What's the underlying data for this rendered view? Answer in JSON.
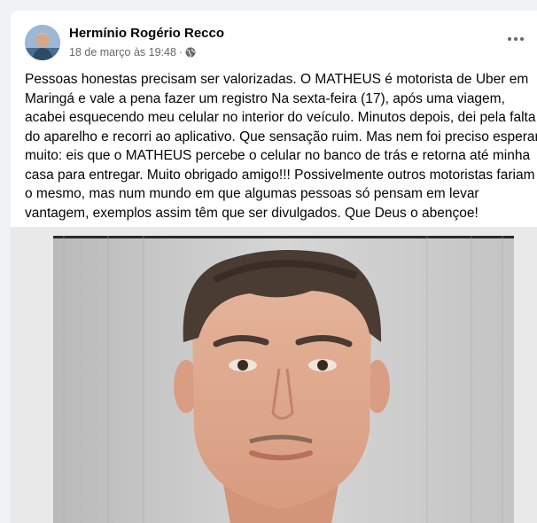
{
  "post": {
    "author": "Hermínio Rogério Recco",
    "date": "18 de março às 19:48",
    "privacy_separator": "·",
    "privacy_icon": "globe-icon",
    "more_icon": "more-options-icon",
    "text_lines": [
      "Pessoas honestas precisam ser valorizadas. O MATHEUS é motorista de Uber em",
      "Maringá e vale a pena fazer um registro  Na sexta-feira (17), após uma viagem,",
      "acabei esquecendo meu celular no interior do veículo. Minutos depois, dei pela falta",
      "do aparelho e recorri ao aplicativo. Que sensação ruim. Mas nem foi preciso esperar",
      "muito: eis que o MATHEUS percebe o celular no banco de trás e retorna até minha",
      "casa para entregar. Muito obrigado amigo!!! Possivelmente outros motoristas fariam",
      "o mesmo, mas num mundo em que algumas pessoas só pensam em levar",
      "vantagem, exemplos assim têm que ser divulgados. Que Deus o abençoe!"
    ]
  },
  "colors": {
    "background": "#f0f2f5",
    "card": "#ffffff",
    "text": "#050505",
    "secondary_text": "#65676b"
  }
}
